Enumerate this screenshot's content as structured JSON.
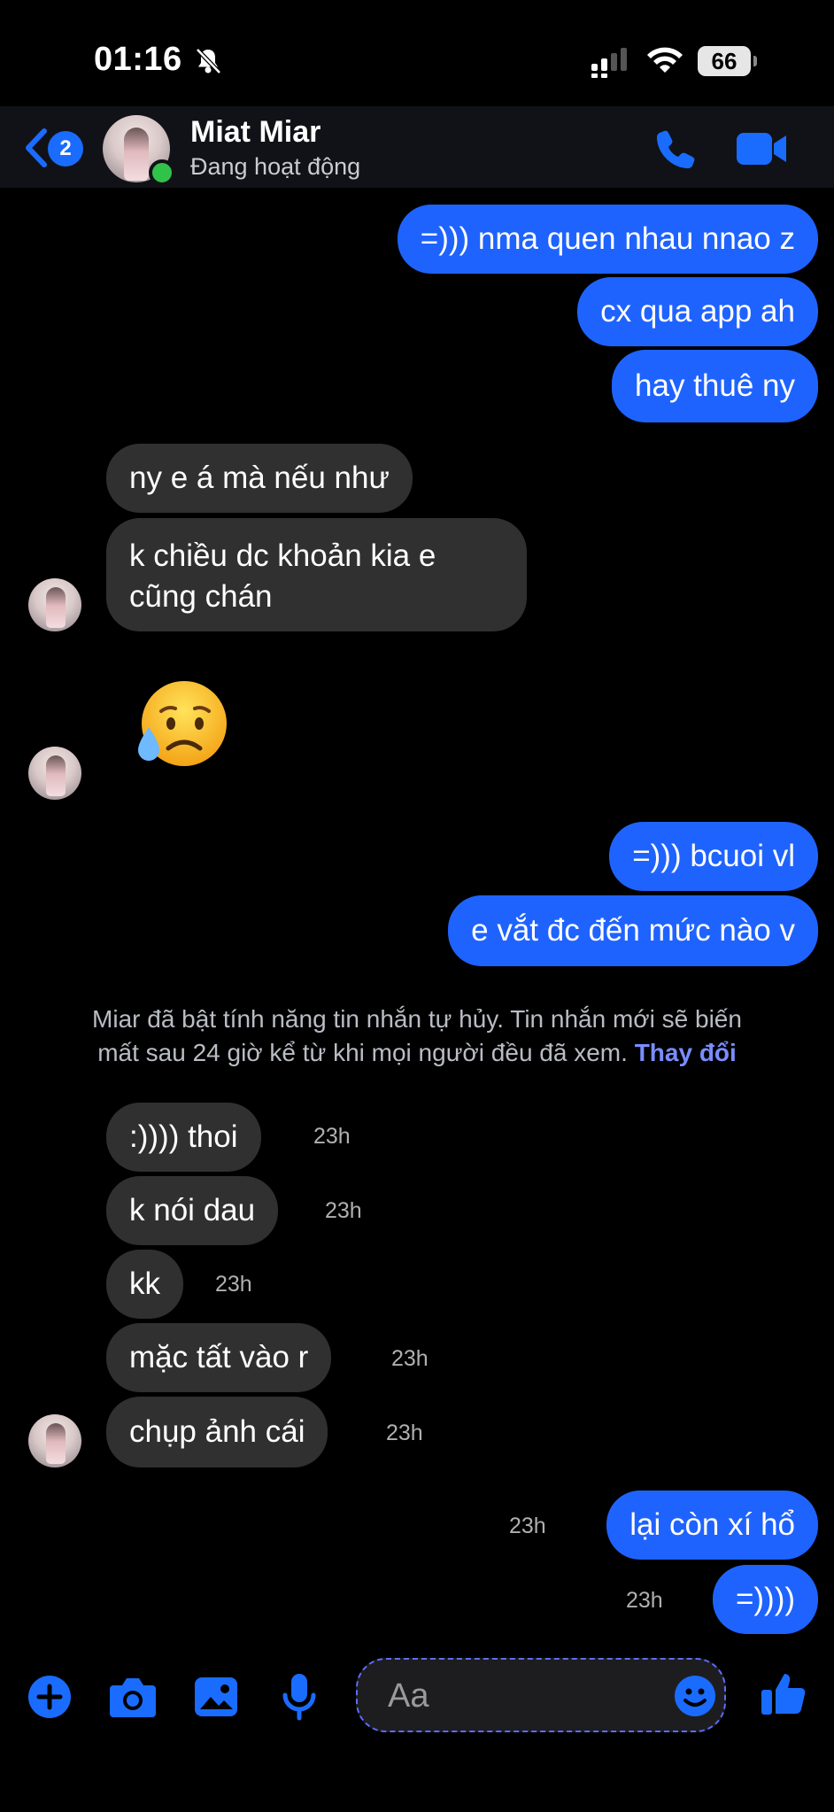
{
  "status_bar": {
    "time": "01:16",
    "battery": "66"
  },
  "header": {
    "back_badge": "2",
    "contact_name": "Miat Miar",
    "presence": "Đang hoạt động"
  },
  "messages": [
    {
      "dir": "out",
      "text": "=))) nma quen nhau nnao z"
    },
    {
      "dir": "out",
      "text": "cx qua app ah"
    },
    {
      "dir": "out",
      "text": "hay thuê ny"
    },
    {
      "dir": "in",
      "text": "ny e á mà nếu như"
    },
    {
      "dir": "in",
      "line1": "k chiều dc khoản kia e",
      "line2": "cũng chán"
    },
    {
      "dir": "in",
      "emoji": "sad-but-relieved-face"
    },
    {
      "dir": "out",
      "text": "=))) bcuoi vl"
    },
    {
      "dir": "out",
      "text": "e vắt đc đến mức nào v"
    },
    {
      "dir": "in",
      "text": ":)))) thoi",
      "time": "23h"
    },
    {
      "dir": "in",
      "text": "k nói dau",
      "time": "23h"
    },
    {
      "dir": "in",
      "text": "kk",
      "time": "23h"
    },
    {
      "dir": "in",
      "text": "mặc tất vào r",
      "time": "23h"
    },
    {
      "dir": "in",
      "text": "chụp ảnh cái",
      "time": "23h"
    },
    {
      "dir": "out",
      "text": "lại còn xí hổ",
      "time": "23h"
    },
    {
      "dir": "out",
      "text": "=))))",
      "time": "23h"
    }
  ],
  "system_notice": {
    "line1": "Miar đã bật tính năng tin nhắn tự hủy. Tin nhắn mới sẽ biến",
    "line2": "mất sau 24 giờ kể từ khi mọi người đều đã xem.",
    "link": "Thay đổi"
  },
  "composer": {
    "placeholder": "Aa"
  },
  "colors": {
    "outgoing_bubble": "#1f63ff",
    "incoming_bubble": "#303030",
    "accent": "#1a6cff",
    "link": "#7a8dff"
  },
  "icons": [
    "bell-slash-icon",
    "cellular-signal-icon",
    "wifi-icon",
    "battery-icon",
    "back-chevron-icon",
    "phone-icon",
    "video-camera-icon",
    "plus-icon",
    "camera-icon",
    "gallery-icon",
    "microphone-icon",
    "smiley-icon",
    "thumbs-up-icon"
  ]
}
